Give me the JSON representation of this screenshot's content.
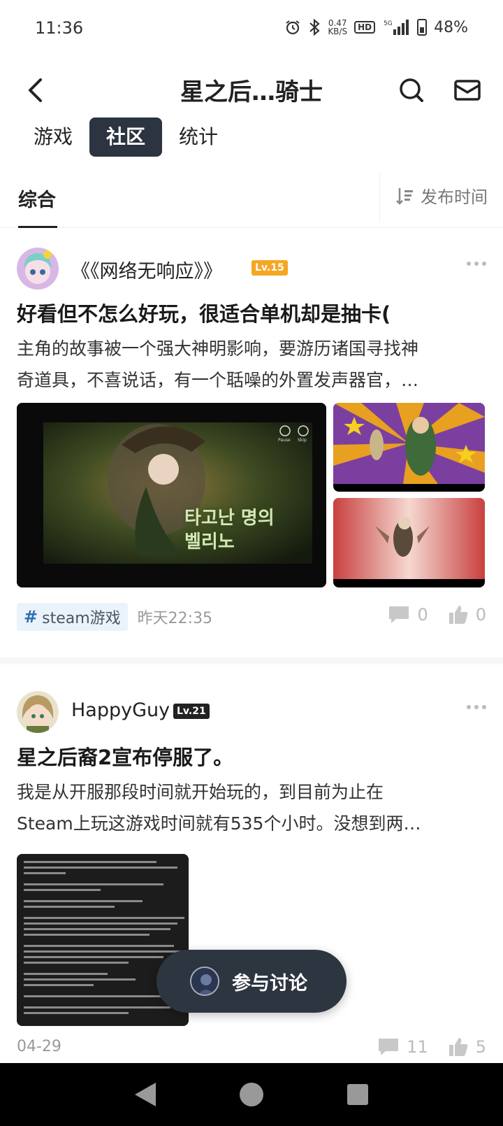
{
  "status_bar": {
    "time": "11:36",
    "net_speed_value": "0.47",
    "net_speed_unit": "KB/S",
    "hd": "HD",
    "signal": "5G",
    "battery": "48%"
  },
  "header": {
    "title": "星之后…骑士",
    "back_icon": "chevron-left-icon",
    "search_icon": "search-icon",
    "mail_icon": "mail-icon"
  },
  "segment_tabs": [
    {
      "label": "游戏",
      "active": false
    },
    {
      "label": "社区",
      "active": true
    },
    {
      "label": "统计",
      "active": false
    }
  ],
  "sub_tabs": {
    "active_label": "综合",
    "sort_label": "发布时间",
    "sort_icon": "sort-icon"
  },
  "posts": [
    {
      "author": "《《网络无响应》》",
      "level": "Lv.15",
      "title": "好看但不怎么好玩，很适合单机却是抽卡(",
      "excerpt_line1": "主角的故事被一个强大神明影响，要游历诸国寻找神",
      "excerpt_line2": "奇道具，不喜说话，有一个聒噪的外置发声器官，…",
      "image_caption": "타고난 명의 벨리노",
      "image_buttons": [
        "Pause",
        "Skip"
      ],
      "tag": "steam游戏",
      "time": "昨天22:35",
      "comments": "0",
      "likes": "0"
    },
    {
      "author": "HappyGuy",
      "level": "Lv.21",
      "title": "星之后裔2宣布停服了。",
      "excerpt_line1": "我是从开服那段时间就开始玩的，到目前为止在",
      "excerpt_line2": "Steam上玩这游戏时间就有535个小时。没想到两…",
      "time": "04-29",
      "comments": "11",
      "likes": "5"
    }
  ],
  "join_button": {
    "label": "参与讨论"
  },
  "colors": {
    "active_tab_bg": "#2b3440",
    "level_orange": "#f5a623",
    "tag_bg": "#eaf2fa",
    "tag_hash": "#2d6fb2"
  }
}
